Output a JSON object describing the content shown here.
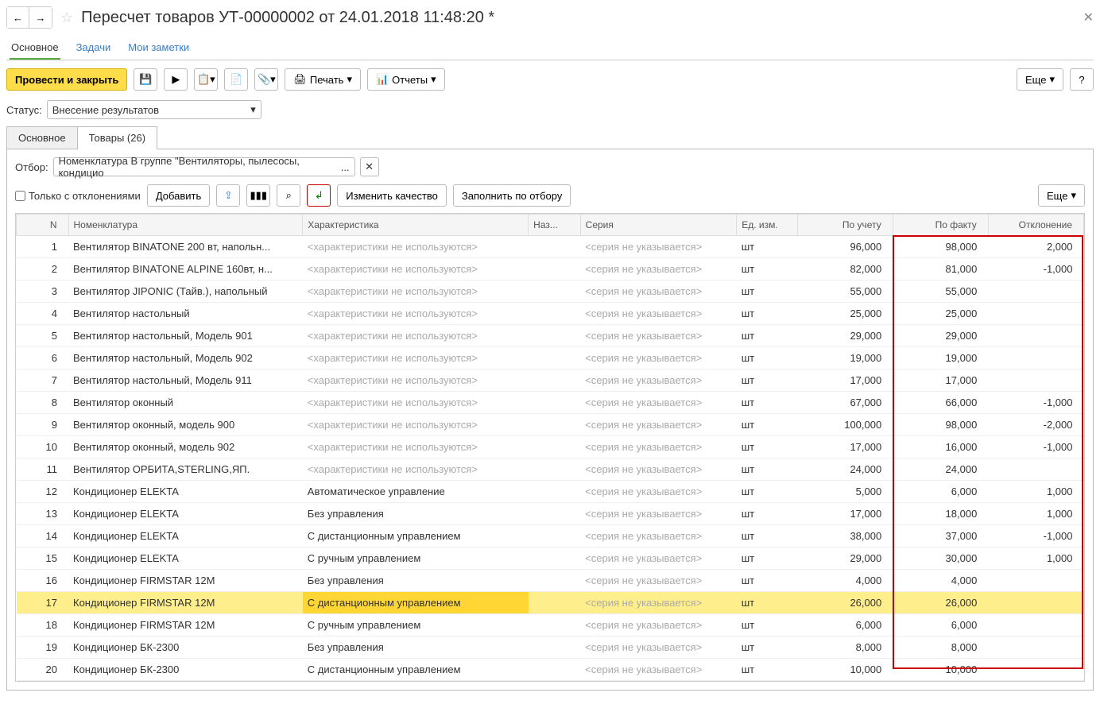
{
  "title": "Пересчет товаров УТ-00000002 от 24.01.2018 11:48:20 *",
  "navTabs": {
    "main": "Основное",
    "tasks": "Задачи",
    "notes": "Мои заметки"
  },
  "toolbar": {
    "process": "Провести и закрыть",
    "print": "Печать",
    "reports": "Отчеты",
    "more": "Еще",
    "help": "?"
  },
  "status": {
    "label": "Статус:",
    "value": "Внесение результатов"
  },
  "tabs2": {
    "main": "Основное",
    "goods": "Товары (26)"
  },
  "filter": {
    "label": "Отбор:",
    "value": "Номенклатура В группе \"Вентиляторы, пылесосы, кондицио"
  },
  "actions": {
    "onlyDev": "Только с отклонениями",
    "add": "Добавить",
    "changeQ": "Изменить качество",
    "fill": "Заполнить по отбору",
    "more": "Еще"
  },
  "columns": {
    "n": "N",
    "nom": "Номенклатура",
    "char": "Характеристика",
    "naz": "Наз...",
    "ser": "Серия",
    "unit": "Ед. изм.",
    "acc": "По учету",
    "fact": "По факту",
    "dev": "Отклонение"
  },
  "placeholders": {
    "char": "<характеристики не используются>",
    "ser": "<серия не указывается>"
  },
  "rows": [
    {
      "n": 1,
      "nom": "Вентилятор BINATONE 200 вт, напольн...",
      "char": null,
      "unit": "шт",
      "acc": "96,000",
      "fact": "98,000",
      "dev": "2,000"
    },
    {
      "n": 2,
      "nom": "Вентилятор BINATONE ALPINE 160вт, н...",
      "char": null,
      "unit": "шт",
      "acc": "82,000",
      "fact": "81,000",
      "dev": "-1,000"
    },
    {
      "n": 3,
      "nom": "Вентилятор JIPONIC (Тайв.), напольный",
      "char": null,
      "unit": "шт",
      "acc": "55,000",
      "fact": "55,000",
      "dev": ""
    },
    {
      "n": 4,
      "nom": "Вентилятор настольный",
      "char": null,
      "unit": "шт",
      "acc": "25,000",
      "fact": "25,000",
      "dev": ""
    },
    {
      "n": 5,
      "nom": "Вентилятор настольный, Модель 901",
      "char": null,
      "unit": "шт",
      "acc": "29,000",
      "fact": "29,000",
      "dev": ""
    },
    {
      "n": 6,
      "nom": "Вентилятор настольный, Модель 902",
      "char": null,
      "unit": "шт",
      "acc": "19,000",
      "fact": "19,000",
      "dev": ""
    },
    {
      "n": 7,
      "nom": "Вентилятор настольный, Модель 911",
      "char": null,
      "unit": "шт",
      "acc": "17,000",
      "fact": "17,000",
      "dev": ""
    },
    {
      "n": 8,
      "nom": "Вентилятор оконный",
      "char": null,
      "unit": "шт",
      "acc": "67,000",
      "fact": "66,000",
      "dev": "-1,000"
    },
    {
      "n": 9,
      "nom": "Вентилятор оконный, модель 900",
      "char": null,
      "unit": "шт",
      "acc": "100,000",
      "fact": "98,000",
      "dev": "-2,000"
    },
    {
      "n": 10,
      "nom": "Вентилятор оконный, модель 902",
      "char": null,
      "unit": "шт",
      "acc": "17,000",
      "fact": "16,000",
      "dev": "-1,000"
    },
    {
      "n": 11,
      "nom": "Вентилятор ОРБИТА,STERLING,ЯП.",
      "char": null,
      "unit": "шт",
      "acc": "24,000",
      "fact": "24,000",
      "dev": ""
    },
    {
      "n": 12,
      "nom": "Кондиционер ELEKTA",
      "char": "Автоматическое управление",
      "unit": "шт",
      "acc": "5,000",
      "fact": "6,000",
      "dev": "1,000"
    },
    {
      "n": 13,
      "nom": "Кондиционер ELEKTA",
      "char": "Без управления",
      "unit": "шт",
      "acc": "17,000",
      "fact": "18,000",
      "dev": "1,000"
    },
    {
      "n": 14,
      "nom": "Кондиционер ELEKTA",
      "char": "С дистанционным управлением",
      "unit": "шт",
      "acc": "38,000",
      "fact": "37,000",
      "dev": "-1,000"
    },
    {
      "n": 15,
      "nom": "Кондиционер ELEKTA",
      "char": "С ручным управлением",
      "unit": "шт",
      "acc": "29,000",
      "fact": "30,000",
      "dev": "1,000"
    },
    {
      "n": 16,
      "nom": "Кондиционер FIRMSTAR 12M",
      "char": "Без управления",
      "unit": "шт",
      "acc": "4,000",
      "fact": "4,000",
      "dev": ""
    },
    {
      "n": 17,
      "nom": "Кондиционер FIRMSTAR 12M",
      "char": "С дистанционным управлением",
      "unit": "шт",
      "acc": "26,000",
      "fact": "26,000",
      "dev": "",
      "selected": true
    },
    {
      "n": 18,
      "nom": "Кондиционер FIRMSTAR 12M",
      "char": "С ручным управлением",
      "unit": "шт",
      "acc": "6,000",
      "fact": "6,000",
      "dev": ""
    },
    {
      "n": 19,
      "nom": "Кондиционер БК-2300",
      "char": "Без управления",
      "unit": "шт",
      "acc": "8,000",
      "fact": "8,000",
      "dev": ""
    },
    {
      "n": 20,
      "nom": "Кондиционер БК-2300",
      "char": "С дистанционным управлением",
      "unit": "шт",
      "acc": "10,000",
      "fact": "10,000",
      "dev": ""
    }
  ]
}
